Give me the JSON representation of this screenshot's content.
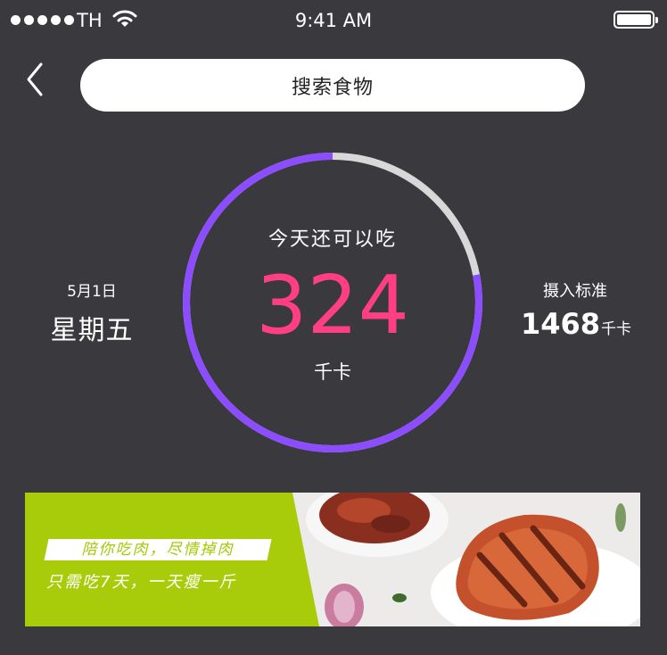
{
  "status_bar": {
    "carrier": "TH",
    "time": "9:41 AM"
  },
  "header": {
    "search_label": "搜索食物"
  },
  "calorie_ring": {
    "label": "今天还可以吃",
    "remaining": "324",
    "unit": "千卡",
    "consumed_fraction": 0.78,
    "colors": {
      "consumed": "#8b4dff",
      "remaining": "#d8d8d8",
      "value": "#ff3f82"
    }
  },
  "date_info": {
    "date": "5月1日",
    "weekday": "星期五"
  },
  "intake_standard": {
    "label": "摄入标准",
    "value": "1468",
    "unit": "千卡"
  },
  "banner": {
    "line1": "陪你吃肉，尽情掉肉",
    "line2": "只需吃7天，一天瘦一斤",
    "accent_color": "#a9cc0a"
  }
}
